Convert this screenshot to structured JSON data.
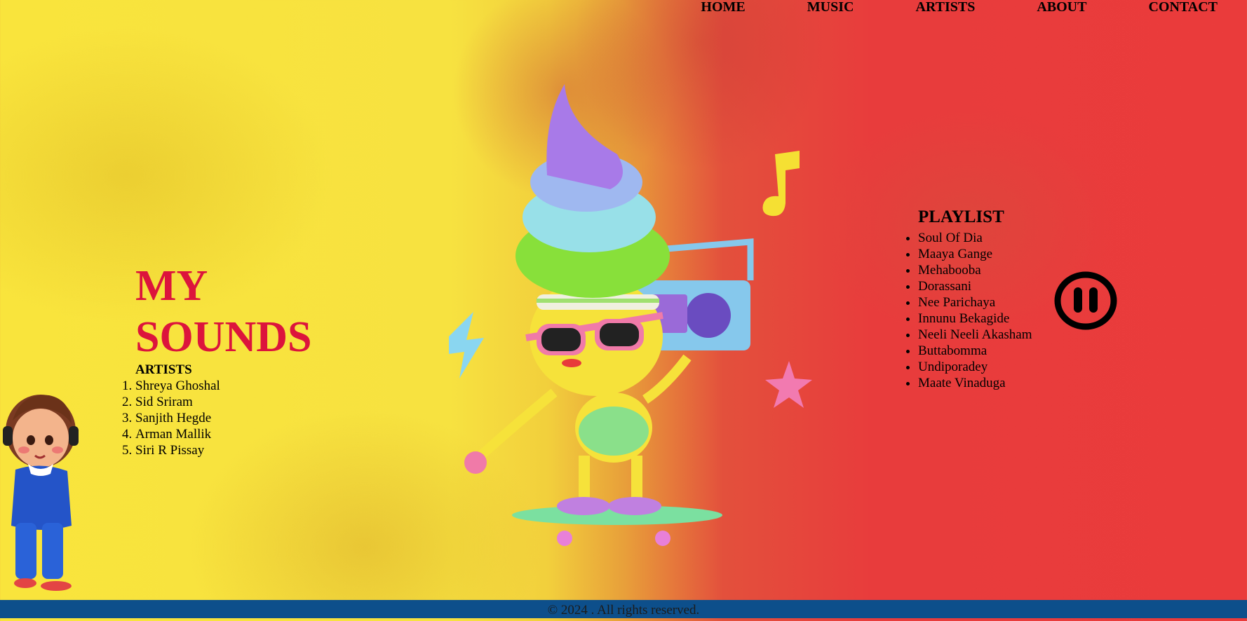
{
  "nav": {
    "items": [
      "HOME",
      "MUSIC",
      "ARTISTS",
      "ABOUT",
      "CONTACT"
    ]
  },
  "hero": {
    "title_line1": "MY",
    "title_line2": "SOUNDS"
  },
  "artists": {
    "heading": "ARTISTS",
    "items": [
      "Shreya Ghoshal",
      "Sid Sriram",
      "Sanjith Hegde",
      "Arman Mallik",
      "Siri R Pissay"
    ]
  },
  "playlist": {
    "heading": "PLAYLIST",
    "items": [
      "Soul Of Dia",
      "Maaya Gange",
      "Mehabooba",
      "Dorassani",
      "Nee Parichaya",
      "Innunu Bekagide",
      "Neeli Neeli Akasham",
      "Buttabomma",
      "Undiporadey",
      "Maate Vinaduga"
    ]
  },
  "player": {
    "state_icon": "pause-icon"
  },
  "footer": {
    "text": "© 2024 . All rights reserved."
  },
  "colors": {
    "title": "#dc143c",
    "footer_bg": "#0d4f8b",
    "bg_left": "#f9e43c",
    "bg_right": "#ea3b3b"
  }
}
